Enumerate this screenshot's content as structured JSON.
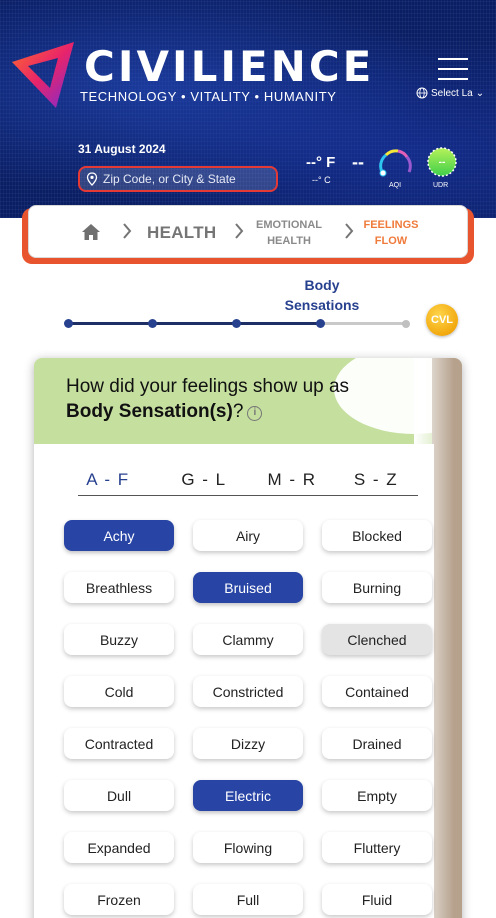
{
  "header": {
    "brand": "CIVILIENCE",
    "tagline": "TECHNOLOGY • VITALITY • HUMANITY",
    "language_label": "Select La",
    "date": "31 August 2024",
    "location_placeholder": "Zip Code, or City & State",
    "temp_f": "--° F",
    "temp_c": "--° C",
    "aqi_value": "--",
    "aqi_label": "AQI",
    "uv_value": "--",
    "uv_label": "UDR"
  },
  "breadcrumb": {
    "level1": "HEALTH",
    "level2_line1": "EMOTIONAL",
    "level2_line2": "HEALTH",
    "level3_line1": "FEELINGS",
    "level3_line2": "FLOW"
  },
  "progress": {
    "current_step_line1": "Body",
    "current_step_line2": "Sensations",
    "steps_total": 5,
    "current_step": 4,
    "badge": "CVL"
  },
  "question": {
    "line1": "How did your feelings show up as",
    "line2_bold": "Body Sensation(s)",
    "line2_rest": "?",
    "info": "i"
  },
  "tabs": [
    {
      "label": "A - F",
      "active": true
    },
    {
      "label": "G - L",
      "active": false
    },
    {
      "label": "M - R",
      "active": false
    },
    {
      "label": "S - Z",
      "active": false
    }
  ],
  "sensations": [
    {
      "label": "Achy",
      "state": "selected"
    },
    {
      "label": "Airy",
      "state": "normal"
    },
    {
      "label": "Blocked",
      "state": "normal"
    },
    {
      "label": "Breathless",
      "state": "normal"
    },
    {
      "label": "Bruised",
      "state": "selected"
    },
    {
      "label": "Burning",
      "state": "normal"
    },
    {
      "label": "Buzzy",
      "state": "normal"
    },
    {
      "label": "Clammy",
      "state": "normal"
    },
    {
      "label": "Clenched",
      "state": "hover"
    },
    {
      "label": "Cold",
      "state": "normal"
    },
    {
      "label": "Constricted",
      "state": "normal"
    },
    {
      "label": "Contained",
      "state": "normal"
    },
    {
      "label": "Contracted",
      "state": "normal"
    },
    {
      "label": "Dizzy",
      "state": "normal"
    },
    {
      "label": "Drained",
      "state": "normal"
    },
    {
      "label": "Dull",
      "state": "normal"
    },
    {
      "label": "Electric",
      "state": "selected"
    },
    {
      "label": "Empty",
      "state": "normal"
    },
    {
      "label": "Expanded",
      "state": "normal"
    },
    {
      "label": "Flowing",
      "state": "normal"
    },
    {
      "label": "Fluttery",
      "state": "normal"
    },
    {
      "label": "Frozen",
      "state": "normal"
    },
    {
      "label": "Full",
      "state": "normal"
    },
    {
      "label": "Fluid",
      "state": "normal"
    }
  ],
  "colors": {
    "brand_blue": "#2845a6",
    "header_bg": "#0a1e63",
    "breadcrumb_accent": "#e8542e",
    "card_header": "#c5df9f"
  }
}
